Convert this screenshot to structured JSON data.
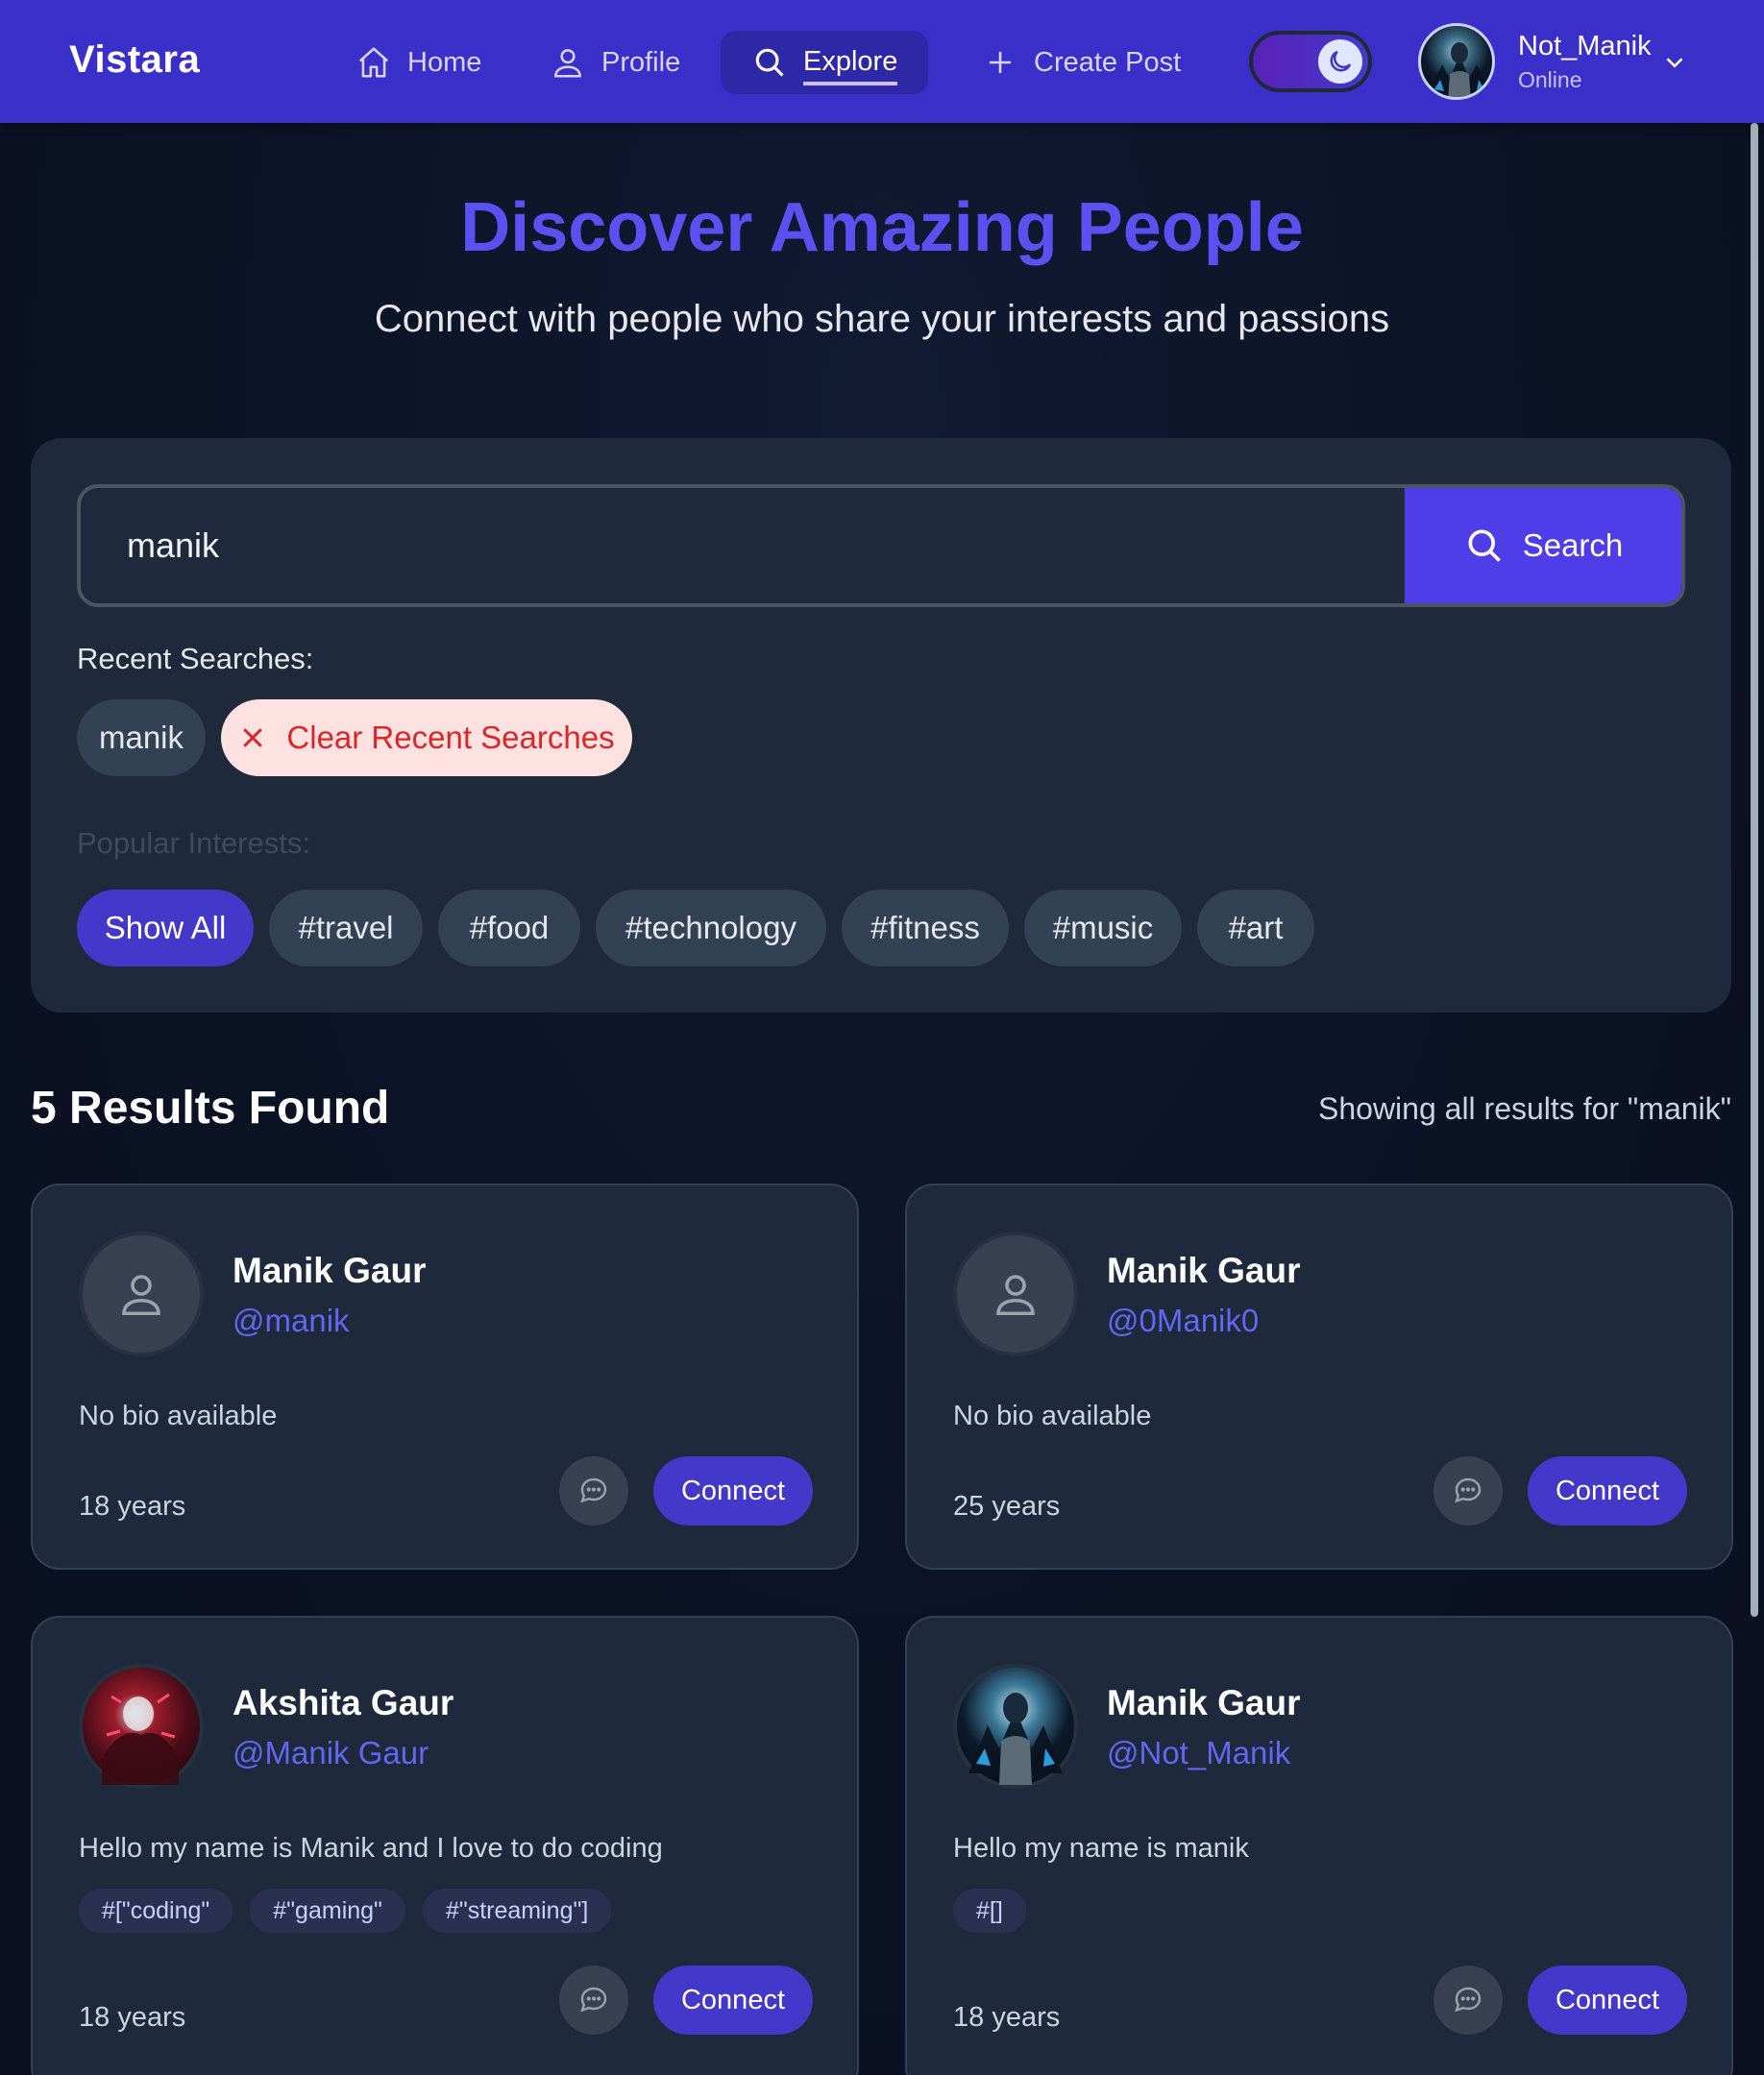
{
  "brand": "Vistara",
  "nav": {
    "home": "Home",
    "profile": "Profile",
    "explore": "Explore",
    "create_post": "Create Post"
  },
  "user": {
    "name": "Not_Manik",
    "status": "Online"
  },
  "hero": {
    "title": "Discover Amazing People",
    "subtitle": "Connect with people who share your interests and passions"
  },
  "search": {
    "value": "manik",
    "button_label": "Search",
    "recent_label": "Recent Searches:",
    "recent": [
      "manik"
    ],
    "clear_label": "Clear Recent Searches",
    "popular_label": "Popular Interests:",
    "interests": [
      "Show All",
      "#travel",
      "#food",
      "#technology",
      "#fitness",
      "#music",
      "#art"
    ]
  },
  "results": {
    "count_label": "5 Results Found",
    "note": "Showing all results for \"manik\"",
    "connect_label": "Connect",
    "cards": [
      {
        "name": "Manik Gaur",
        "handle": "@manik",
        "bio": "No bio available",
        "tags": [],
        "age": "18 years",
        "avatar": "default"
      },
      {
        "name": "Manik Gaur",
        "handle": "@0Manik0",
        "bio": "No bio available",
        "tags": [],
        "age": "25 years",
        "avatar": "default"
      },
      {
        "name": "Akshita Gaur",
        "handle": "@Manik Gaur",
        "bio": "Hello my name is Manik and I love to do coding",
        "tags": [
          "#[\"coding\"",
          "#\"gaming\"",
          "#\"streaming\"]"
        ],
        "age": "18 years",
        "avatar": "photo-red"
      },
      {
        "name": "Manik Gaur",
        "handle": "@Not_Manik",
        "bio": "Hello my name is manik",
        "tags": [
          "#[]"
        ],
        "age": "18 years",
        "avatar": "photo-blue"
      }
    ]
  },
  "colors": {
    "nav_bg": "#3b2fc9",
    "accent": "#4f3ee8",
    "title": "#5b50f0",
    "panel": "#1e293b",
    "clear_chip_bg": "#fee2e2",
    "clear_chip_text": "#dc2626"
  },
  "icons": [
    "home-icon",
    "user-icon",
    "search-icon",
    "plus-icon",
    "moon-icon",
    "chevron-down-icon",
    "close-icon",
    "message-icon",
    "default-avatar-icon"
  ]
}
